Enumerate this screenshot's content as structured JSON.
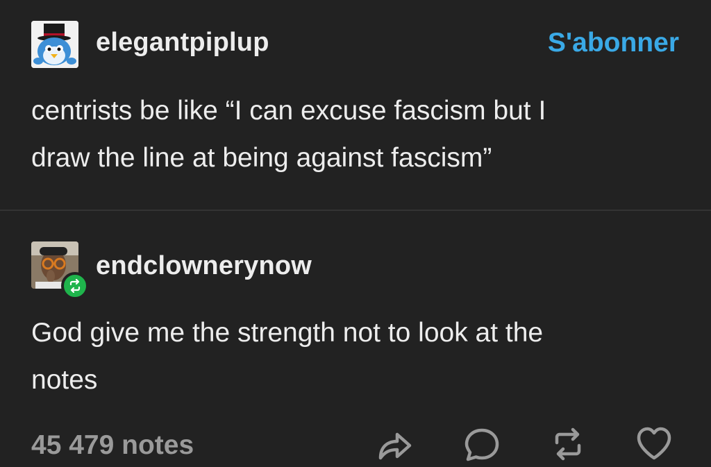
{
  "original_post": {
    "username": "elegantpiplup",
    "follow_label": "S'abonner",
    "body_lines": [
      "centrists be like “I can excuse fascism but I",
      "draw the line at being against fascism”"
    ],
    "avatar_icon": "piplup-with-top-hat-avatar"
  },
  "reblog": {
    "username": "endclownerynow",
    "body_lines": [
      "God give me the strength not to look at the",
      "notes"
    ],
    "avatar_icon": "person-with-glasses-avatar",
    "badge_icon": "reblog-badge-icon"
  },
  "footer": {
    "notes_label": "45 479 notes",
    "actions": [
      "share-icon",
      "reply-icon",
      "reblog-icon",
      "like-icon"
    ]
  },
  "colors": {
    "background": "#222222",
    "accent": "#3aa9e6",
    "reblog_green": "#1fb44c",
    "text": "#ededed",
    "muted": "#9a9a9a"
  }
}
